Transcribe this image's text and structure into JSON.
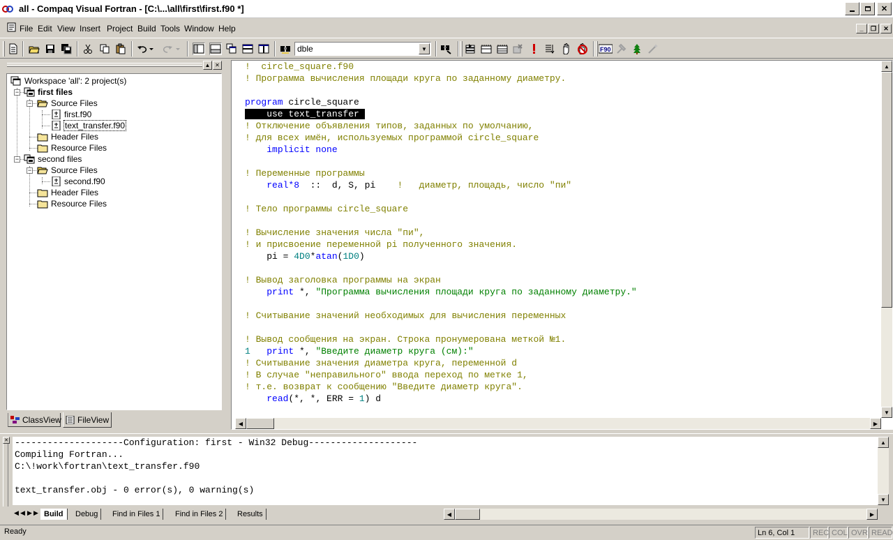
{
  "window": {
    "title": "all - Compaq Visual Fortran - [C:\\...\\all\\first\\first.f90 *]"
  },
  "menu": [
    "File",
    "Edit",
    "View",
    "Insert",
    "Project",
    "Build",
    "Tools",
    "Window",
    "Help"
  ],
  "toolbar": {
    "combo_value": "dble",
    "icons": [
      "new-text-file-icon",
      "open-icon",
      "save-icon",
      "save-all-icon",
      "cut-icon",
      "copy-icon",
      "paste-icon",
      "undo-icon",
      "redo-icon",
      "workspace-icon",
      "output-icon",
      "windows-list-icon",
      "split-horizontal-icon",
      "split-vertical-icon",
      "find-in-files-icon",
      "find-icon",
      "compile-icon",
      "build-icon",
      "rebuild-icon",
      "stop-build-icon",
      "execute-icon",
      "go-icon",
      "insert-breakpoint-icon",
      "remove-breakpoints-icon",
      "f90-icon",
      "tools-icon",
      "tree-icon",
      "wand-icon"
    ]
  },
  "workspace": {
    "tree": [
      {
        "label": "Workspace 'all': 2 project(s)",
        "kind": "workspace",
        "bold": false
      },
      {
        "label": "first files",
        "kind": "project",
        "bold": true
      },
      {
        "label": "Source Files",
        "kind": "folder"
      },
      {
        "label": "first.f90",
        "kind": "file"
      },
      {
        "label": "text_transfer.f90",
        "kind": "file",
        "selected": true
      },
      {
        "label": "Header Files",
        "kind": "folder"
      },
      {
        "label": "Resource Files",
        "kind": "folder"
      },
      {
        "label": "second files",
        "kind": "project",
        "bold": false
      },
      {
        "label": "Source Files",
        "kind": "folder"
      },
      {
        "label": "second.f90",
        "kind": "file"
      },
      {
        "label": "Header Files",
        "kind": "folder"
      },
      {
        "label": "Resource Files",
        "kind": "folder"
      }
    ],
    "tabs": [
      "ClassView",
      "FileView"
    ]
  },
  "editor": {
    "lines": [
      [
        [
          "c-com",
          "!  circle_square.f90"
        ]
      ],
      [
        [
          "c-com",
          "! Программа вычисления площади круга по заданному диаметру."
        ]
      ],
      [],
      [
        [
          "c-kw",
          "program"
        ],
        [
          "c-plain",
          " circle_square"
        ]
      ],
      [
        [
          "c-sel",
          "    use text_transfer "
        ]
      ],
      [
        [
          "c-com",
          "! Отключение объявления типов, заданных по умолчанию,"
        ]
      ],
      [
        [
          "c-com",
          "! для всех имён, используемых программой circle_square"
        ]
      ],
      [
        [
          "c-plain",
          "    "
        ],
        [
          "c-kw",
          "implicit none"
        ]
      ],
      [],
      [
        [
          "c-com",
          "! Переменные программы"
        ]
      ],
      [
        [
          "c-plain",
          "    "
        ],
        [
          "c-kw",
          "real*8"
        ],
        [
          "c-plain",
          "  ::  d, S, pi    "
        ],
        [
          "c-com",
          "!   диаметр, площадь, число \"пи\""
        ]
      ],
      [],
      [
        [
          "c-com",
          "! Тело программы circle_square"
        ]
      ],
      [],
      [
        [
          "c-com",
          "! Вычисление значения числа \"пи\","
        ]
      ],
      [
        [
          "c-com",
          "! и присвоение переменной pi полученного значения."
        ]
      ],
      [
        [
          "c-plain",
          "    pi = "
        ],
        [
          "c-num",
          "4D0"
        ],
        [
          "c-plain",
          "*"
        ],
        [
          "c-kw",
          "atan"
        ],
        [
          "c-plain",
          "("
        ],
        [
          "c-num",
          "1D0"
        ],
        [
          "c-plain",
          ")"
        ]
      ],
      [],
      [
        [
          "c-com",
          "! Вывод заголовка программы на экран"
        ]
      ],
      [
        [
          "c-plain",
          "    "
        ],
        [
          "c-kw",
          "print"
        ],
        [
          "c-plain",
          " *, "
        ],
        [
          "c-str",
          "\"Программа вычисления площади круга по заданному диаметру.\""
        ]
      ],
      [],
      [
        [
          "c-com",
          "! Считывание значений необходимых для вычисления переменных"
        ]
      ],
      [],
      [
        [
          "c-com",
          "! Вывод сообщения на экран. Строка пронумерована меткой №1."
        ]
      ],
      [
        [
          "c-num",
          "1"
        ],
        [
          "c-plain",
          "   "
        ],
        [
          "c-kw",
          "print"
        ],
        [
          "c-plain",
          " *, "
        ],
        [
          "c-str",
          "\"Введите диаметр круга (см):\""
        ]
      ],
      [
        [
          "c-com",
          "! Считывание значения диаметра круга, переменной d"
        ]
      ],
      [
        [
          "c-com",
          "! В случае \"неправильного\" ввода переход по метке 1,"
        ]
      ],
      [
        [
          "c-com",
          "! т.е. возврат к сообщению \"Введите диаметр круга\"."
        ]
      ],
      [
        [
          "c-plain",
          "    "
        ],
        [
          "c-kw",
          "read"
        ],
        [
          "c-plain",
          "(*, *, ERR = "
        ],
        [
          "c-num",
          "1"
        ],
        [
          "c-plain",
          ") d"
        ]
      ]
    ]
  },
  "output": {
    "lines": [
      "--------------------Configuration: first - Win32 Debug--------------------",
      "Compiling Fortran...",
      "C:\\!work\\fortran\\text_transfer.f90",
      "",
      "text_transfer.obj - 0 error(s), 0 warning(s)"
    ],
    "tabs": [
      "Build",
      "Debug",
      "Find in Files 1",
      "Find in Files 2",
      "Results"
    ]
  },
  "status": {
    "ready": "Ready",
    "position": "Ln 6, Col 1",
    "indicators": [
      "REC",
      "COL",
      "OVR",
      "READ"
    ]
  }
}
